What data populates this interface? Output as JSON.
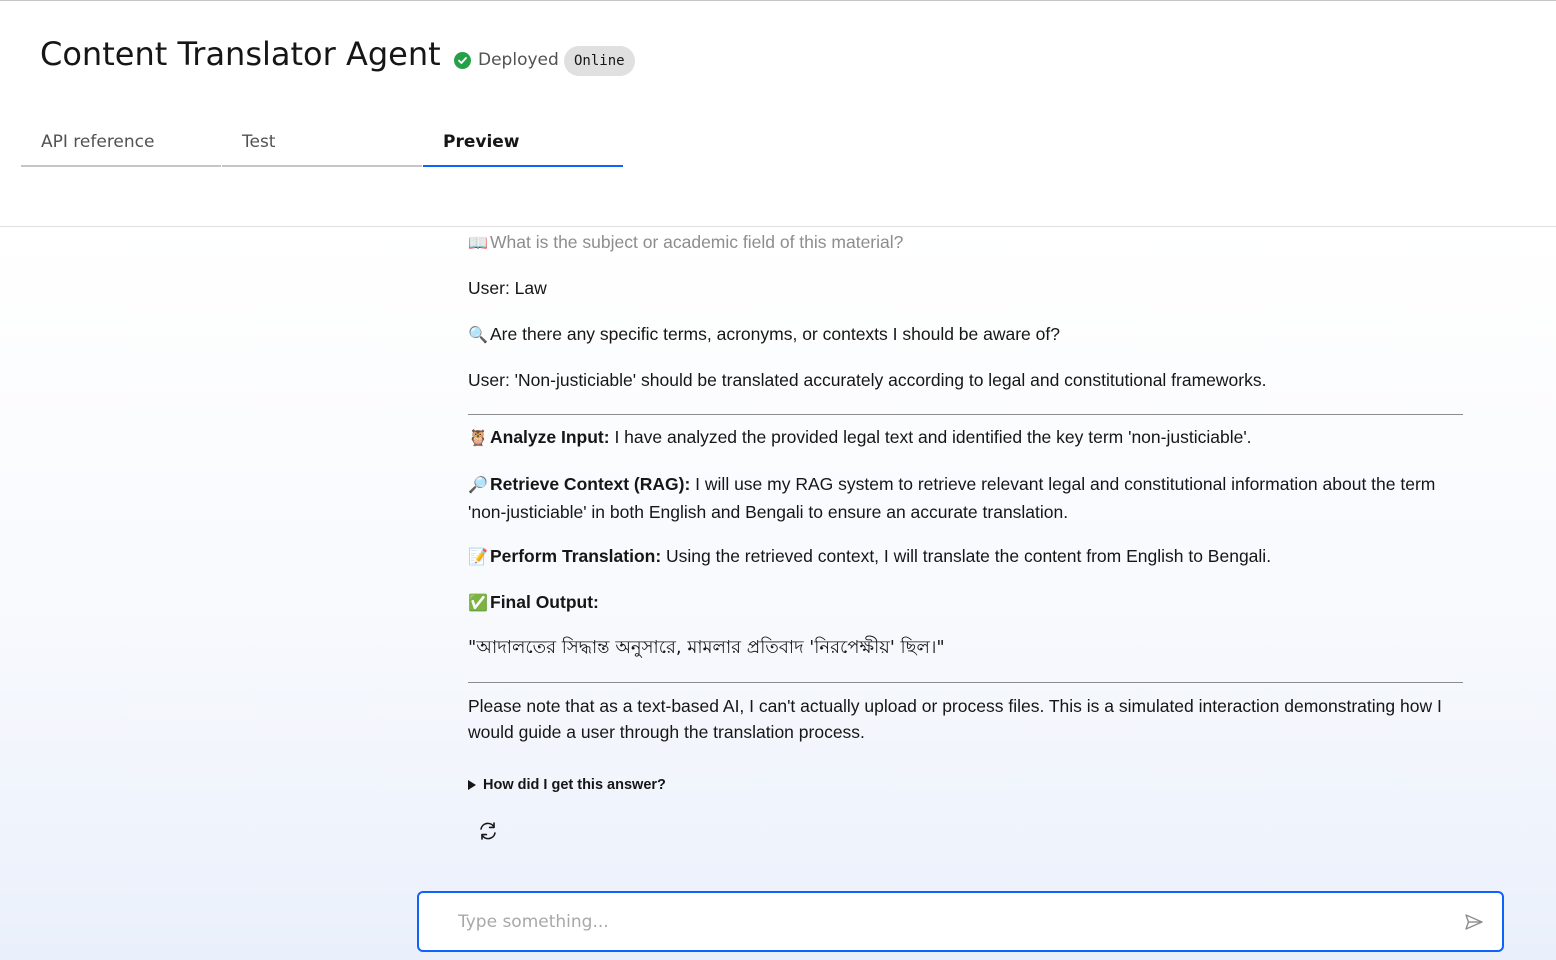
{
  "header": {
    "title": "Content Translator Agent",
    "status": "Deployed",
    "badge": "Online"
  },
  "tabs": [
    {
      "label": "API reference",
      "active": false
    },
    {
      "label": "Test",
      "active": false
    },
    {
      "label": "Preview",
      "active": true
    }
  ],
  "conversation": {
    "question_subject": "What is the subject or academic field of this material?",
    "user_subject": "User: Law",
    "question_terms": "Are there any specific terms, acronyms, or contexts I should be aware of?",
    "user_terms": "User: 'Non-justiciable' should be translated accurately according to legal and constitutional frameworks.",
    "steps": [
      {
        "icon": "owl-icon",
        "emoji": "🦉",
        "title": "Analyze Input:",
        "text": " I have analyzed the provided legal text and identified the key term 'non-justiciable'."
      },
      {
        "icon": "magnifier-icon",
        "emoji": "🔎",
        "title": "Retrieve Context (RAG):",
        "text": " I will use my RAG system to retrieve relevant legal and constitutional information about the term 'non-justiciable' in both English and Bengali to ensure an accurate translation."
      },
      {
        "icon": "memo-icon",
        "emoji": "📝",
        "title": "Perform Translation:",
        "text": " Using the retrieved context, I will translate the content from English to Bengali."
      },
      {
        "icon": "check-mark-icon",
        "emoji": "✅",
        "title": "Final Output:",
        "text": ""
      }
    ],
    "final_output": "\"আদালতের সিদ্ধান্ত অনুসারে, মামলার প্রতিবাদ 'নিরপেক্ষীয়' ছিল।\"",
    "note": "Please note that as a text-based AI, I can't actually upload or process files. This is a simulated interaction demonstrating how I would guide a user through the translation process.",
    "disclosure": "How did I get this answer?"
  },
  "icons": {
    "subject": "📖",
    "terms": "🔍"
  },
  "input": {
    "placeholder": "Type something..."
  },
  "colors": {
    "accent": "#0f62fe",
    "success": "#24a148"
  }
}
